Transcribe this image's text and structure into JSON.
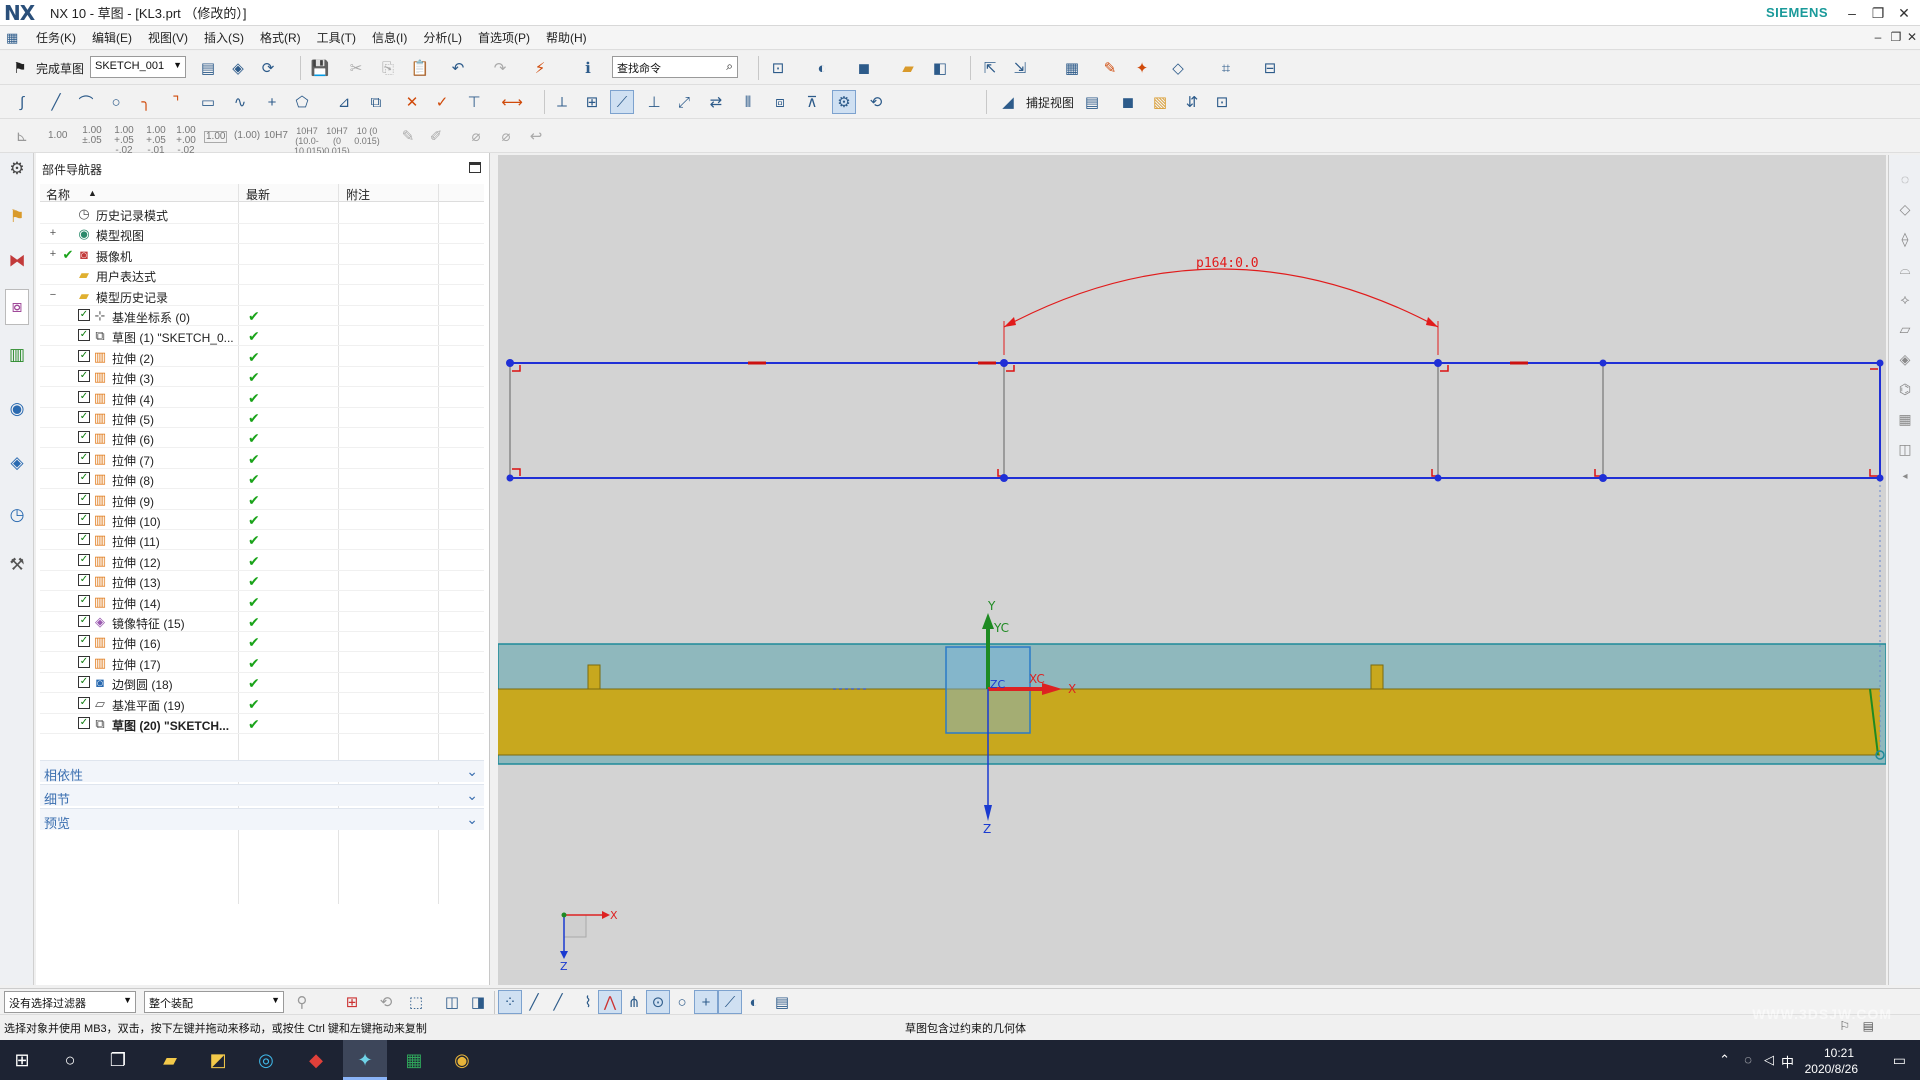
{
  "window": {
    "app_logo": "NX",
    "title": "NX 10 - 草图 - [KL3.prt （修改的）]",
    "brand": "SIEMENS",
    "controls": [
      "–",
      "❐",
      "✕"
    ]
  },
  "menu": {
    "items": [
      "任务(K)",
      "编辑(E)",
      "视图(V)",
      "插入(S)",
      "格式(R)",
      "工具(T)",
      "信息(I)",
      "分析(L)",
      "首选项(P)",
      "帮助(H)"
    ]
  },
  "toolbar1": {
    "finish_sketch_label": "完成草图",
    "sketch_select_value": "SKETCH_001",
    "command_search_value": "查找命令"
  },
  "toolbar2": {
    "snap_view_label": "捕捉视图"
  },
  "toolbar3": {
    "dim_values": [
      "1.00",
      "1.00 ±.05",
      "1.00 +.05 -.02",
      "1.00 +.05 -.01",
      "1.00 +.00 -.02",
      "1.00",
      "(1.00)",
      "10H7",
      "10H7 (10.0-10.015)",
      "10H7 (0 0.015)",
      "10 (0 0.015)"
    ]
  },
  "navigator": {
    "title": "部件导航器",
    "columns": [
      "名称",
      "最新",
      "附注"
    ],
    "top_items": [
      {
        "label": "历史记录模式",
        "icon": "clock-icon"
      },
      {
        "label": "模型视图",
        "icon": "model-views-icon",
        "expand": "+"
      },
      {
        "label": "摄像机",
        "icon": "camera-icon",
        "expand": "+"
      },
      {
        "label": "用户表达式",
        "icon": "folder-icon"
      },
      {
        "label": "模型历史记录",
        "icon": "folder-icon",
        "expand": "−"
      }
    ],
    "history": [
      {
        "label": "基准坐标系 (0)",
        "icon": "datum-csys-icon"
      },
      {
        "label": "草图 (1) \"SKETCH_0...",
        "icon": "sketch-icon"
      },
      {
        "label": "拉伸 (2)",
        "icon": "extrude-icon"
      },
      {
        "label": "拉伸 (3)",
        "icon": "extrude-icon"
      },
      {
        "label": "拉伸 (4)",
        "icon": "extrude-icon"
      },
      {
        "label": "拉伸 (5)",
        "icon": "extrude-icon"
      },
      {
        "label": "拉伸 (6)",
        "icon": "extrude-icon"
      },
      {
        "label": "拉伸 (7)",
        "icon": "extrude-icon"
      },
      {
        "label": "拉伸 (8)",
        "icon": "extrude-icon"
      },
      {
        "label": "拉伸 (9)",
        "icon": "extrude-icon"
      },
      {
        "label": "拉伸 (10)",
        "icon": "extrude-icon"
      },
      {
        "label": "拉伸 (11)",
        "icon": "extrude-icon"
      },
      {
        "label": "拉伸 (12)",
        "icon": "extrude-icon"
      },
      {
        "label": "拉伸 (13)",
        "icon": "extrude-icon"
      },
      {
        "label": "拉伸 (14)",
        "icon": "extrude-icon"
      },
      {
        "label": "镜像特征 (15)",
        "icon": "mirror-feature-icon"
      },
      {
        "label": "拉伸 (16)",
        "icon": "extrude-icon"
      },
      {
        "label": "拉伸 (17)",
        "icon": "extrude-icon"
      },
      {
        "label": "边倒圆 (18)",
        "icon": "edge-blend-icon"
      },
      {
        "label": "基准平面 (19)",
        "icon": "datum-plane-icon"
      },
      {
        "label": "草图 (20) \"SKETCH...",
        "icon": "sketch-icon",
        "bold": true
      }
    ],
    "panels": [
      "相依性",
      "细节",
      "预览"
    ],
    "status_mark": "✔"
  },
  "graphics": {
    "dimension_label": "p164:0.0",
    "axis_labels": {
      "y": "Y",
      "yc": "YC",
      "xc": "XC",
      "x": "X",
      "zc": "ZC",
      "z": "Z"
    },
    "triad_labels": {
      "x": "X",
      "z": "Z"
    }
  },
  "filterbar": {
    "selection_filter_value": "没有选择过滤器",
    "scope_value": "整个装配"
  },
  "status": {
    "left_message": "选择对象并使用 MB3，双击，按下左键并拖动来移动，或按住 Ctrl 键和左键拖动来复制",
    "center_message": "草图包含过约束的几何体"
  },
  "taskbar": {
    "time": "10:21",
    "date": "2020/8/26",
    "ime": "中",
    "watermark": "WWW.3DSJW.COM"
  },
  "colors": {
    "sketch_blue": "#1f2fd6",
    "dimension_red": "#e11b1b",
    "part_yellow": "#c8a81e",
    "part_teal": "#8fb8bd",
    "graphics_bg": "#d3d3d3"
  }
}
